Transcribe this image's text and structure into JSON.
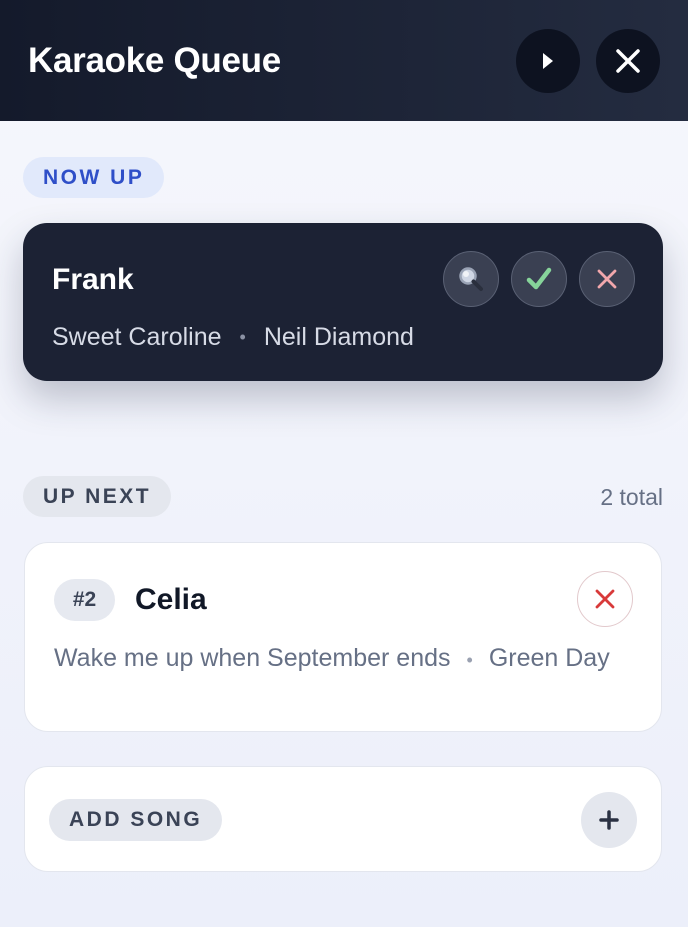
{
  "header": {
    "title": "Karaoke Queue",
    "play_icon": "play-icon",
    "close_icon": "close-icon"
  },
  "now_up": {
    "label": "NOW UP",
    "singer": "Frank",
    "song": "Sweet Caroline",
    "separator": "•",
    "artist": "Neil Diamond",
    "actions": [
      "search-icon",
      "check-icon",
      "remove-icon"
    ]
  },
  "up_next": {
    "label": "UP NEXT",
    "total": "2 total",
    "items": [
      {
        "rank": "#2",
        "singer": "Celia",
        "song": "Wake me up when September ends",
        "separator": "•",
        "artist": "Green Day"
      }
    ]
  },
  "add_song": {
    "label": "ADD SONG",
    "icon": "plus-icon"
  },
  "colors": {
    "header_bg": "#141a2b",
    "now_card_bg": "#1c2234",
    "accent_blue": "#2f4fc8",
    "check_green": "#86d39a",
    "remove_red": "#d83a3a"
  }
}
